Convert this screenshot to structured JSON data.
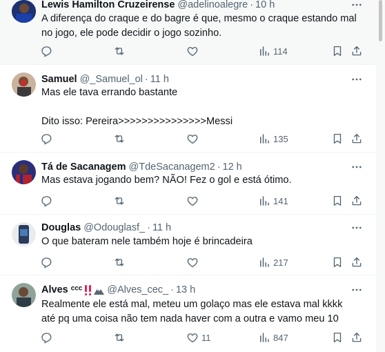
{
  "tweets": [
    {
      "name": "Lewis Hamilton Cruzeirense",
      "handle": "@adelinoalegre",
      "time": "10 h",
      "text": "A diferença do craque e do bagre é que, mesmo o craque estando mal no jogo, ele pode decidir o jogo sozinho.",
      "views": "114",
      "likes": ""
    },
    {
      "name": "Samuel",
      "handle": "@_Samuel_ol",
      "time": "11 h",
      "text": "Mas ele tava errando bastante\n\nDito isso: Pereira>>>>>>>>>>>>>>>Messi",
      "views": "135",
      "likes": ""
    },
    {
      "name": "Tá de Sacanagem",
      "handle": "@TdeSacanagem2",
      "time": "12 h",
      "text": "Mas estava jogando bem? NÃO! Fez o gol e está ótimo.",
      "views": "141",
      "likes": ""
    },
    {
      "name": "Douglas",
      "handle": "@Odouglasf_",
      "time": "11 h",
      "text": "O que bateram nele também hoje é brincadeira",
      "views": "217",
      "likes": ""
    },
    {
      "name": "Alves ᶜᶜᶜ",
      "handle": "@Alves_cec_",
      "time": "13 h",
      "text": "Realmente ele está mal, meteu um golaço mas ele estava mal kkkk até pq uma coisa não tem nada haver com a outra e vamo meu 10",
      "views": "847",
      "likes": "11"
    }
  ],
  "separator": "·",
  "colors": {
    "text_primary": "#0f1419",
    "text_secondary": "#536471",
    "divider": "#eff3f4",
    "highlight_bg": "#f7f9f9",
    "emoji_red": "#e0245e"
  },
  "icons": {
    "reply": "reply-icon",
    "repost": "repost-icon",
    "like": "heart-icon",
    "views": "views-icon",
    "bookmark": "bookmark-icon",
    "share": "share-icon",
    "more": "more-icon"
  }
}
